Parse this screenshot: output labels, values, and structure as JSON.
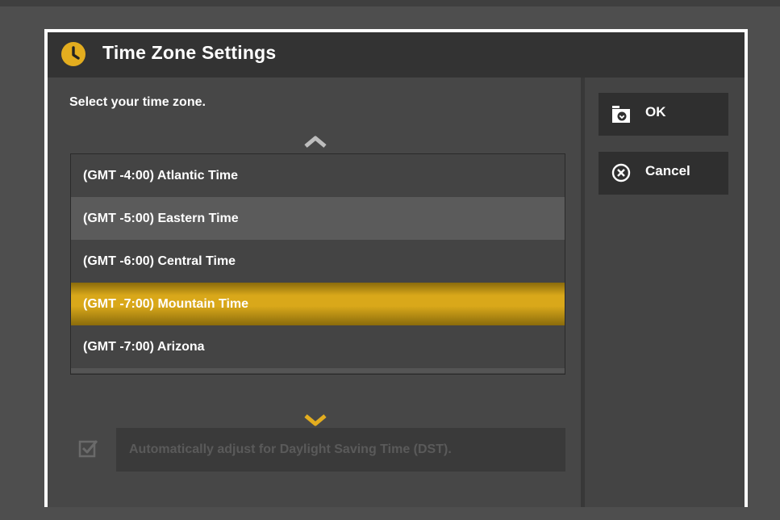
{
  "dialog": {
    "title": "Time Zone Settings",
    "title_icon": "clock-icon",
    "instruction": "Select your time zone."
  },
  "timezones": {
    "items": [
      "(GMT -4:00) Atlantic Time",
      "(GMT -5:00) Eastern Time",
      "(GMT -6:00) Central Time",
      "(GMT -7:00) Mountain Time",
      "(GMT -7:00) Arizona"
    ],
    "selected": "(GMT -7:00) Mountain Time"
  },
  "dst": {
    "label": "Automatically adjust for Daylight Saving Time (DST).",
    "checked": true,
    "enabled": false
  },
  "buttons": {
    "ok_label": "OK",
    "ok_icon": "folder-check-icon",
    "cancel_label": "Cancel",
    "cancel_icon": "x-circle-icon"
  },
  "colors": {
    "accent": "#d9a81a",
    "background": "#474747",
    "titlebar": "#333333",
    "border": "#ffffff"
  }
}
